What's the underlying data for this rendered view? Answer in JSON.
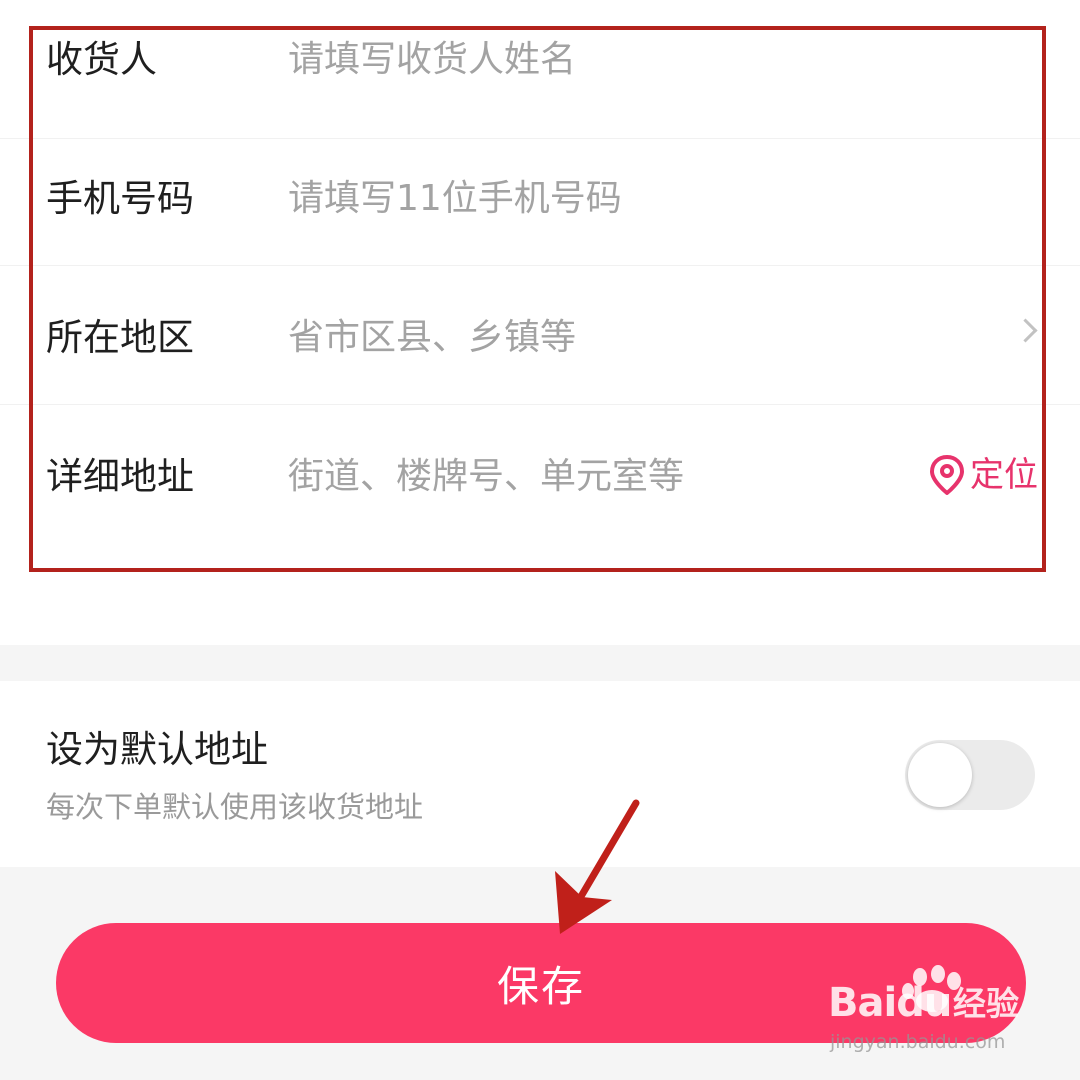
{
  "form": {
    "rows": [
      {
        "label": "收货人",
        "placeholder": "请填写收货人姓名"
      },
      {
        "label": "手机号码",
        "placeholder": "请填写11位手机号码"
      },
      {
        "label": "所在地区",
        "placeholder": "省市区县、乡镇等",
        "trailing_icon": "chevron-right-icon"
      },
      {
        "label": "详细地址",
        "placeholder": "街道、楼牌号、单元室等",
        "action": {
          "icon": "location-pin-icon",
          "label": "定位"
        }
      }
    ]
  },
  "default_address": {
    "title": "设为默认地址",
    "subtitle": "每次下单默认使用该收货地址",
    "toggle_on": false
  },
  "save_button": {
    "label": "保存"
  },
  "watermark": {
    "brand": "Baidu",
    "product": "经验",
    "url": "jingyan.baidu.com"
  },
  "colors": {
    "accent": "#fb3966",
    "locate": "#e7336c",
    "highlight_border": "#b3221c",
    "annotation_arrow": "#c0201a",
    "placeholder": "#a3a3a3",
    "label": "#1f1f1f"
  }
}
